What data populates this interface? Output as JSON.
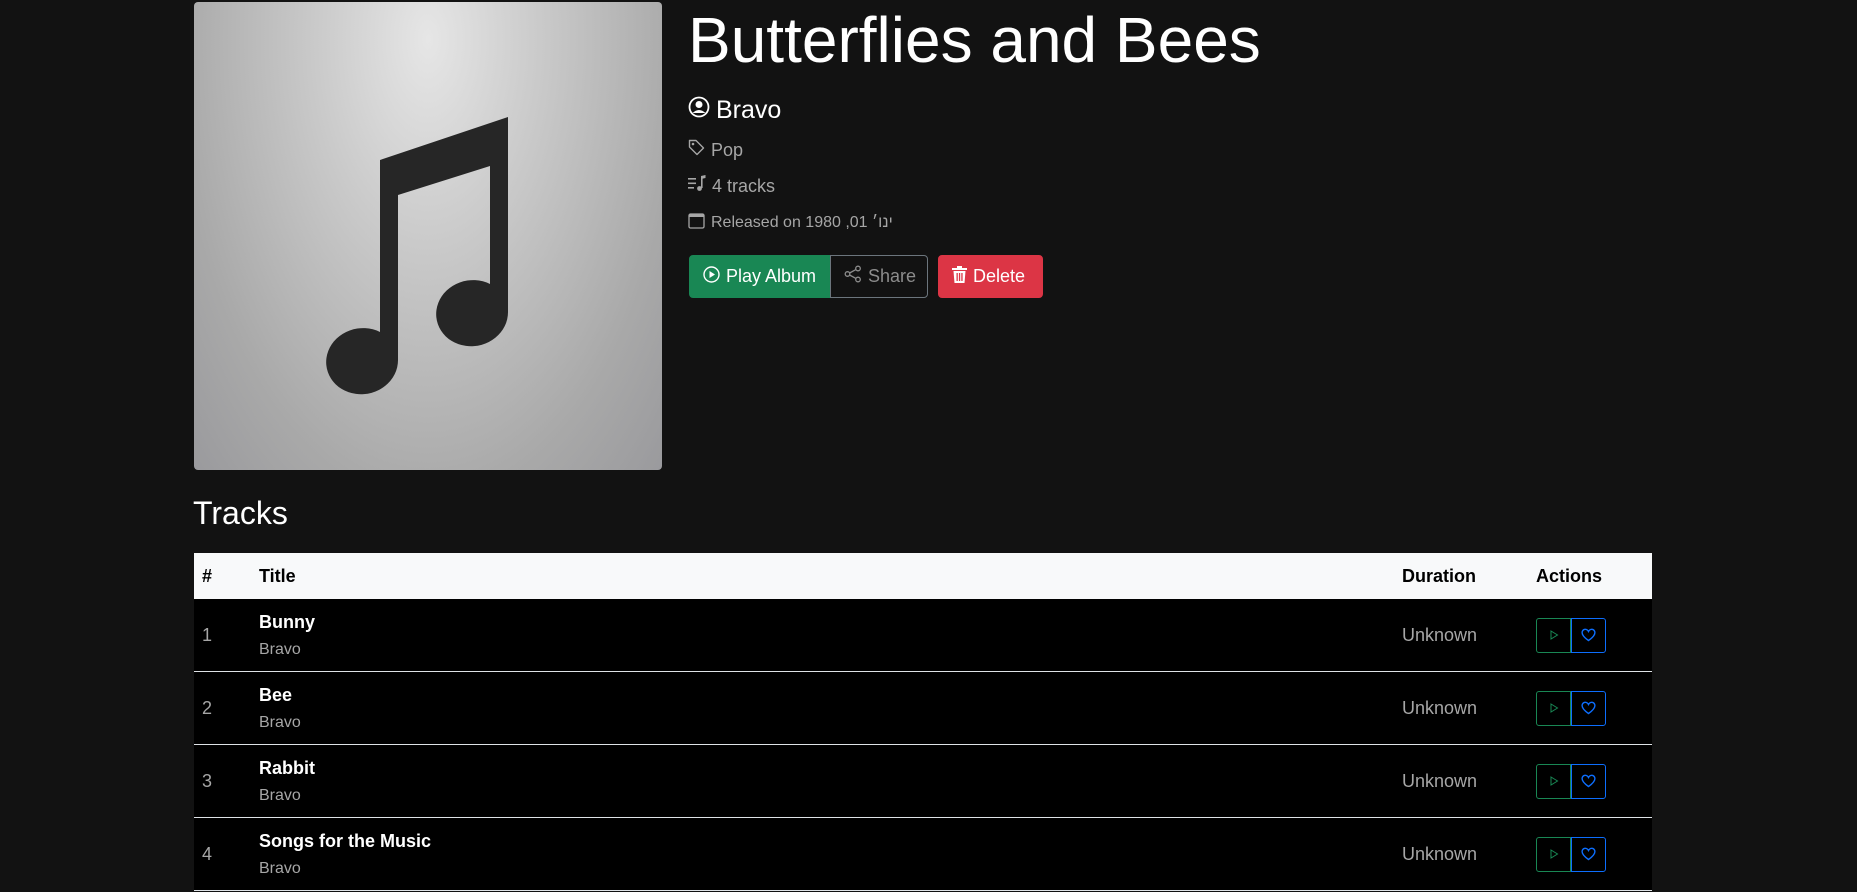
{
  "album": {
    "title": "Butterflies and Bees",
    "artist": "Bravo",
    "genre": "Pop",
    "track_count": "4 tracks",
    "release_text": "Released on ינו׳ 01, 1980",
    "cover_icon": "music-note-icon"
  },
  "actions": {
    "play_label": "Play Album",
    "share_label": "Share",
    "delete_label": "Delete"
  },
  "tracks_section": {
    "heading": "Tracks",
    "columns": {
      "num": "#",
      "title": "Title",
      "duration": "Duration",
      "actions": "Actions"
    },
    "rows": [
      {
        "num": "1",
        "title": "Bunny",
        "artist": "Bravo",
        "duration": "Unknown"
      },
      {
        "num": "2",
        "title": "Bee",
        "artist": "Bravo",
        "duration": "Unknown"
      },
      {
        "num": "3",
        "title": "Rabbit",
        "artist": "Bravo",
        "duration": "Unknown"
      },
      {
        "num": "4",
        "title": "Songs for the Music",
        "artist": "Bravo",
        "duration": "Unknown"
      }
    ]
  },
  "colors": {
    "background": "#121212",
    "play": "#198754",
    "delete": "#dc3545",
    "like": "#0d6efd"
  }
}
